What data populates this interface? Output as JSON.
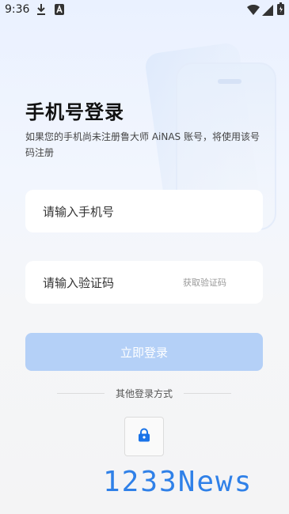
{
  "status_bar": {
    "time": "9:36",
    "icons": [
      "download-icon",
      "a-icon",
      "wifi-icon",
      "signal-icon",
      "battery-icon"
    ]
  },
  "header": {
    "title": "手机号登录",
    "subtitle": "如果您的手机尚未注册鲁大师 AiNAS 账号，将使用该号码注册"
  },
  "form": {
    "phone_placeholder": "请输入手机号",
    "code_placeholder": "请输入验证码",
    "get_code_label": "获取验证码",
    "submit_label": "立即登录"
  },
  "other_login": {
    "label": "其他登录方式",
    "methods": [
      "lock-icon"
    ]
  },
  "watermark": {
    "text": "1233News"
  },
  "colors": {
    "accent": "#1a73e8",
    "button_disabled": "#b4d0f7",
    "background": "#f4f4f5"
  }
}
